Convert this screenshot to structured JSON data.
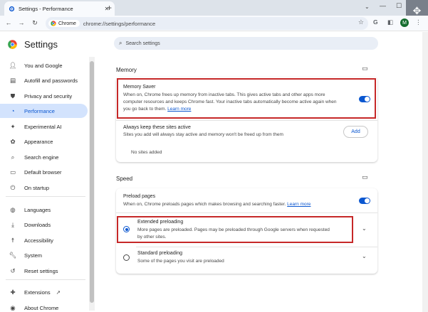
{
  "browser": {
    "tab_title": "Settings - Performance",
    "new_tab_label": "+",
    "url_chip": "Chrome",
    "url": "chrome://settings/performance",
    "avatar_initial": "M"
  },
  "settings": {
    "title": "Settings",
    "search_placeholder": "Search settings"
  },
  "sidebar": {
    "items": [
      {
        "label": "You and Google",
        "icon": "person-icon"
      },
      {
        "label": "Autofill and passwords",
        "icon": "clipboard-icon"
      },
      {
        "label": "Privacy and security",
        "icon": "shield-icon"
      },
      {
        "label": "Performance",
        "icon": "speedometer-icon"
      },
      {
        "label": "Experimental AI",
        "icon": "sparkle-icon"
      },
      {
        "label": "Appearance",
        "icon": "palette-icon"
      },
      {
        "label": "Search engine",
        "icon": "search-icon"
      },
      {
        "label": "Default browser",
        "icon": "browser-icon"
      },
      {
        "label": "On startup",
        "icon": "power-icon"
      },
      {
        "label": "Languages",
        "icon": "globe-icon"
      },
      {
        "label": "Downloads",
        "icon": "download-icon"
      },
      {
        "label": "Accessibility",
        "icon": "accessibility-icon"
      },
      {
        "label": "System",
        "icon": "wrench-icon"
      },
      {
        "label": "Reset settings",
        "icon": "reset-icon"
      },
      {
        "label": "Extensions",
        "icon": "puzzle-icon"
      },
      {
        "label": "About Chrome",
        "icon": "chrome-icon"
      }
    ]
  },
  "memory": {
    "section_title": "Memory",
    "memory_saver_title": "Memory Saver",
    "memory_saver_desc_1": "When on, Chrome frees up memory from inactive tabs. This gives active tabs and other apps more",
    "memory_saver_desc_2": "computer resources and keeps Chrome fast. Your inactive tabs automatically become active again when",
    "memory_saver_desc_3": "you go back to them.",
    "learn_more": "Learn more",
    "always_active_title": "Always keep these sites active",
    "always_active_desc": "Sites you add will always stay active and memory won't be freed up from them",
    "add_button": "Add",
    "no_sites": "No sites added"
  },
  "speed": {
    "section_title": "Speed",
    "preload_title": "Preload pages",
    "preload_desc": "When on, Chrome preloads pages which makes browsing and searching faster.",
    "learn_more": "Learn more",
    "extended_title": "Extended preloading",
    "extended_desc_1": "More pages are preloaded. Pages may be preloaded through Google servers when requested",
    "extended_desc_2": "by other sites.",
    "standard_title": "Standard preloading",
    "standard_desc": "Some of the pages you visit are preloaded"
  },
  "colors": {
    "accent": "#0b57d0",
    "highlight_box": "#c62828",
    "active_nav_bg": "#d3e3fd"
  }
}
